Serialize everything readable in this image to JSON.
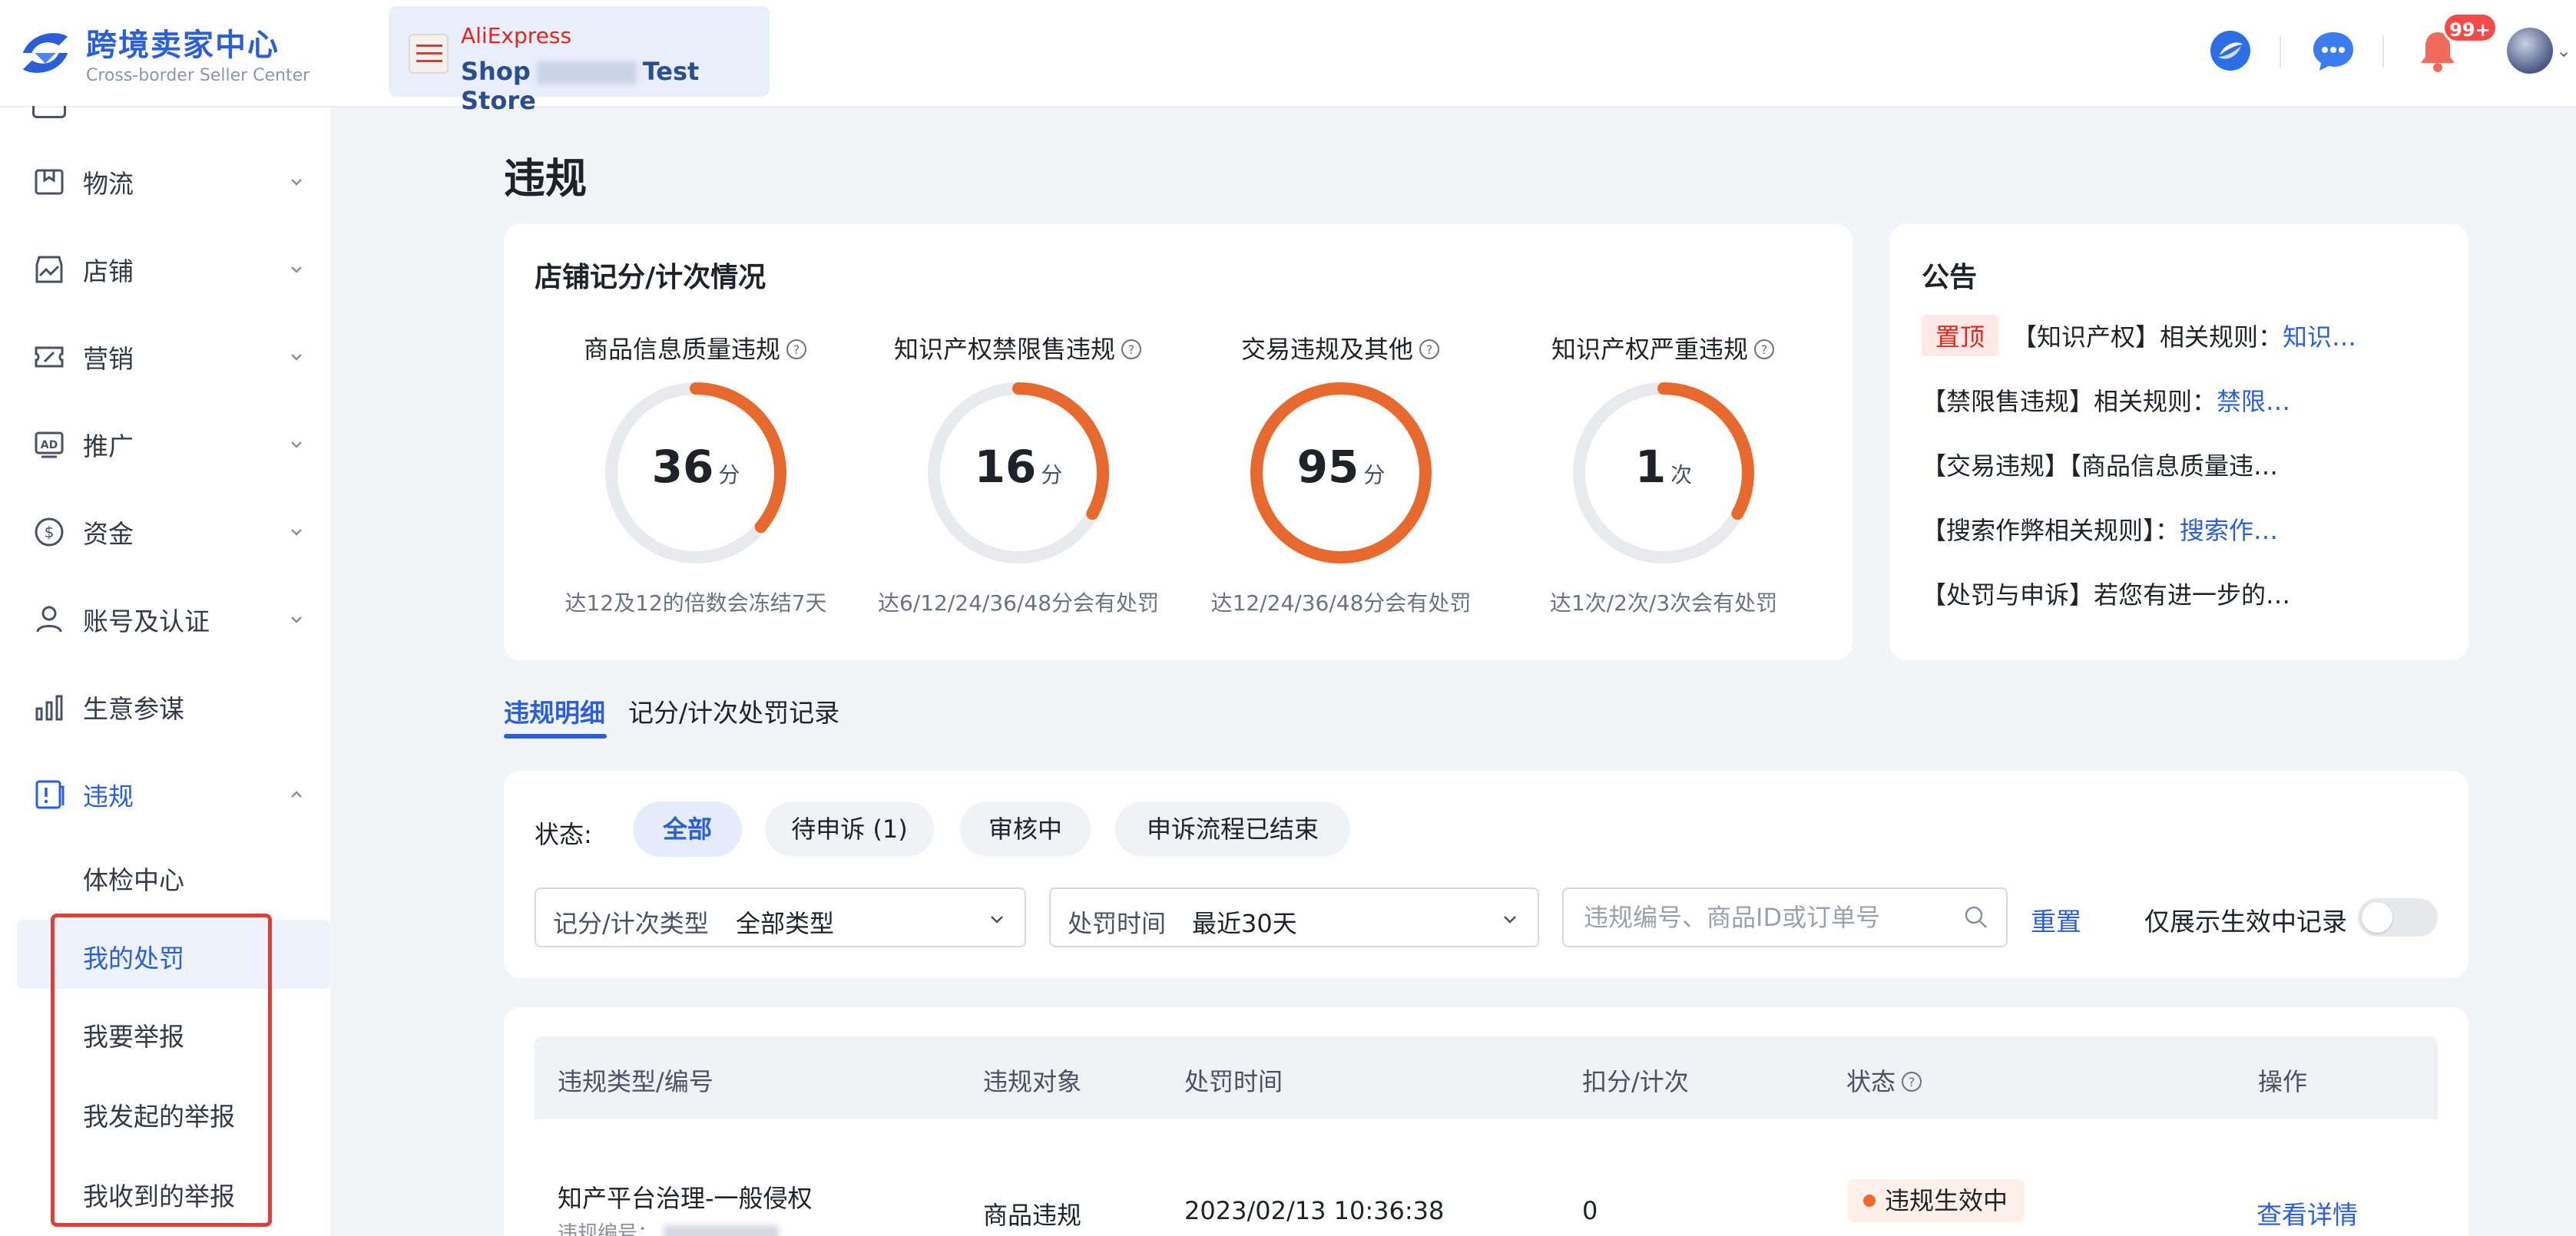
{
  "colors": {
    "primary": "#2b5fd9",
    "ring": "#e8692d",
    "ring_track": "#e9eaee",
    "danger": "#e1251b"
  },
  "header": {
    "logo_title": "跨境卖家中心",
    "logo_subtitle": "Cross-border Seller Center",
    "store_platform": "AliExpress",
    "store_name_prefix": "Shop",
    "store_name_suffix": "Test Store",
    "notification_count": "99+",
    "icons": [
      "compass-icon",
      "chat-icon",
      "bell-icon",
      "avatar"
    ]
  },
  "sidebar": {
    "items": [
      {
        "label": "物流",
        "icon": "package-icon"
      },
      {
        "label": "店铺",
        "icon": "shop-icon"
      },
      {
        "label": "营销",
        "icon": "ticket-icon"
      },
      {
        "label": "推广",
        "icon": "ad-icon"
      },
      {
        "label": "资金",
        "icon": "dollar-icon"
      },
      {
        "label": "账号及认证",
        "icon": "user-icon"
      },
      {
        "label": "生意参谋",
        "icon": "bar-chart-icon"
      },
      {
        "label": "违规",
        "icon": "violation-icon"
      }
    ],
    "sub_items": [
      {
        "label": "体检中心",
        "active": false
      },
      {
        "label": "我的处罚",
        "active": true
      },
      {
        "label": "我要举报",
        "active": false
      },
      {
        "label": "我发起的举报",
        "active": false
      },
      {
        "label": "我收到的举报",
        "active": false
      }
    ]
  },
  "page": {
    "title": "违规",
    "score_card": {
      "title": "店铺记分/计次情况",
      "metrics": [
        {
          "label": "商品信息质量违规",
          "value": "36",
          "unit": "分",
          "note": "达12及12的倍数会冻结7天",
          "fill": 0.36
        },
        {
          "label": "知识产权禁限售违规",
          "value": "16",
          "unit": "分",
          "note": "达6/12/24/36/48分会有处罚",
          "fill": 0.33
        },
        {
          "label": "交易违规及其他",
          "value": "95",
          "unit": "分",
          "note": "达12/24/36/48分会有处罚",
          "fill": 1.0
        },
        {
          "label": "知识产权严重违规",
          "value": "1",
          "unit": "次",
          "note": "达1次/2次/3次会有处罚",
          "fill": 0.33
        }
      ]
    },
    "announcement": {
      "title": "公告",
      "pin_tag": "置顶",
      "lines": [
        {
          "text": "【知识产权】相关规则：",
          "link": "知识…"
        },
        {
          "text": "【禁限售违规】相关规则：",
          "link": "禁限…"
        },
        {
          "text": "【交易违规】【商品信息质量违…",
          "link": ""
        },
        {
          "text": "【搜索作弊相关规则】：",
          "link": "搜索作…"
        },
        {
          "text": "【处罚与申诉】若您有进一步的…",
          "link": ""
        }
      ]
    },
    "tabs": [
      {
        "label": "违规明细",
        "active": true
      },
      {
        "label": "记分/计次处罚记录",
        "active": false
      }
    ],
    "filters": {
      "status_label": "状态:",
      "chips": [
        {
          "label": "全部",
          "active": true
        },
        {
          "label": "待申诉 (1)",
          "active": false
        },
        {
          "label": "审核中",
          "active": false
        },
        {
          "label": "申诉流程已结束",
          "active": false
        }
      ],
      "type_select": {
        "label": "记分/计次类型",
        "value": "全部类型"
      },
      "time_select": {
        "label": "处罚时间",
        "value": "最近30天"
      },
      "search_placeholder": "违规编号、商品ID或订单号",
      "reset_label": "重置",
      "toggle_label": "仅展示生效中记录",
      "toggle_on": false
    },
    "table": {
      "columns": [
        "违规类型/编号",
        "违规对象",
        "处罚时间",
        "扣分/计次",
        "状态",
        "操作"
      ],
      "rows": [
        {
          "type": "知产平台治理-一般侵权",
          "number_label": "违规编号：",
          "target": "商品违规",
          "time": "2023/02/13 10:36:38",
          "points": "0",
          "status": "违规生效中",
          "action": "查看详情"
        }
      ]
    }
  }
}
